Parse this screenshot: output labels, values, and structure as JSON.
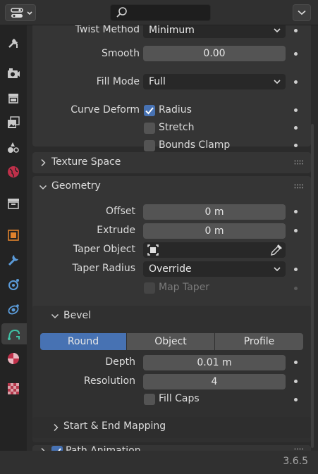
{
  "properties": {
    "twist_method": {
      "label": "Twist Method",
      "value": "Minimum"
    },
    "smooth": {
      "label": "Smooth",
      "value": "0.00"
    },
    "fill_mode": {
      "label": "Fill Mode",
      "value": "Full"
    },
    "curve_deform": {
      "label": "Curve Deform",
      "radius": "Radius",
      "stretch": "Stretch",
      "bounds_clamp": "Bounds Clamp"
    }
  },
  "panels": {
    "texture_space": "Texture Space",
    "geometry": {
      "title": "Geometry",
      "offset": {
        "label": "Offset",
        "value": "0 m"
      },
      "extrude": {
        "label": "Extrude",
        "value": "0 m"
      },
      "taper_object": {
        "label": "Taper Object"
      },
      "taper_radius": {
        "label": "Taper Radius",
        "value": "Override"
      },
      "map_taper": "Map Taper"
    },
    "bevel": {
      "title": "Bevel",
      "modes": [
        "Round",
        "Object",
        "Profile"
      ],
      "active_mode": "Round",
      "depth": {
        "label": "Depth",
        "value": "0.01 m"
      },
      "resolution": {
        "label": "Resolution",
        "value": "4"
      },
      "fill_caps": "Fill Caps"
    },
    "start_end_mapping": "Start & End Mapping",
    "path_animation": "Path Animation"
  },
  "status": {
    "version": "3.6.5"
  },
  "colors": {
    "accent": "#4772b3",
    "panel": "#353535",
    "background": "#2b2b2b"
  },
  "icons": [
    "editor-type-icon",
    "search-icon",
    "chevron-down-icon",
    "tool-icon",
    "render-icon",
    "output-icon",
    "view-layer-icon",
    "scene-icon",
    "world-icon",
    "collection-icon",
    "object-icon",
    "modifier-icon",
    "particles-icon",
    "physics-icon",
    "curve-data-icon",
    "material-icon",
    "texture-icon"
  ]
}
